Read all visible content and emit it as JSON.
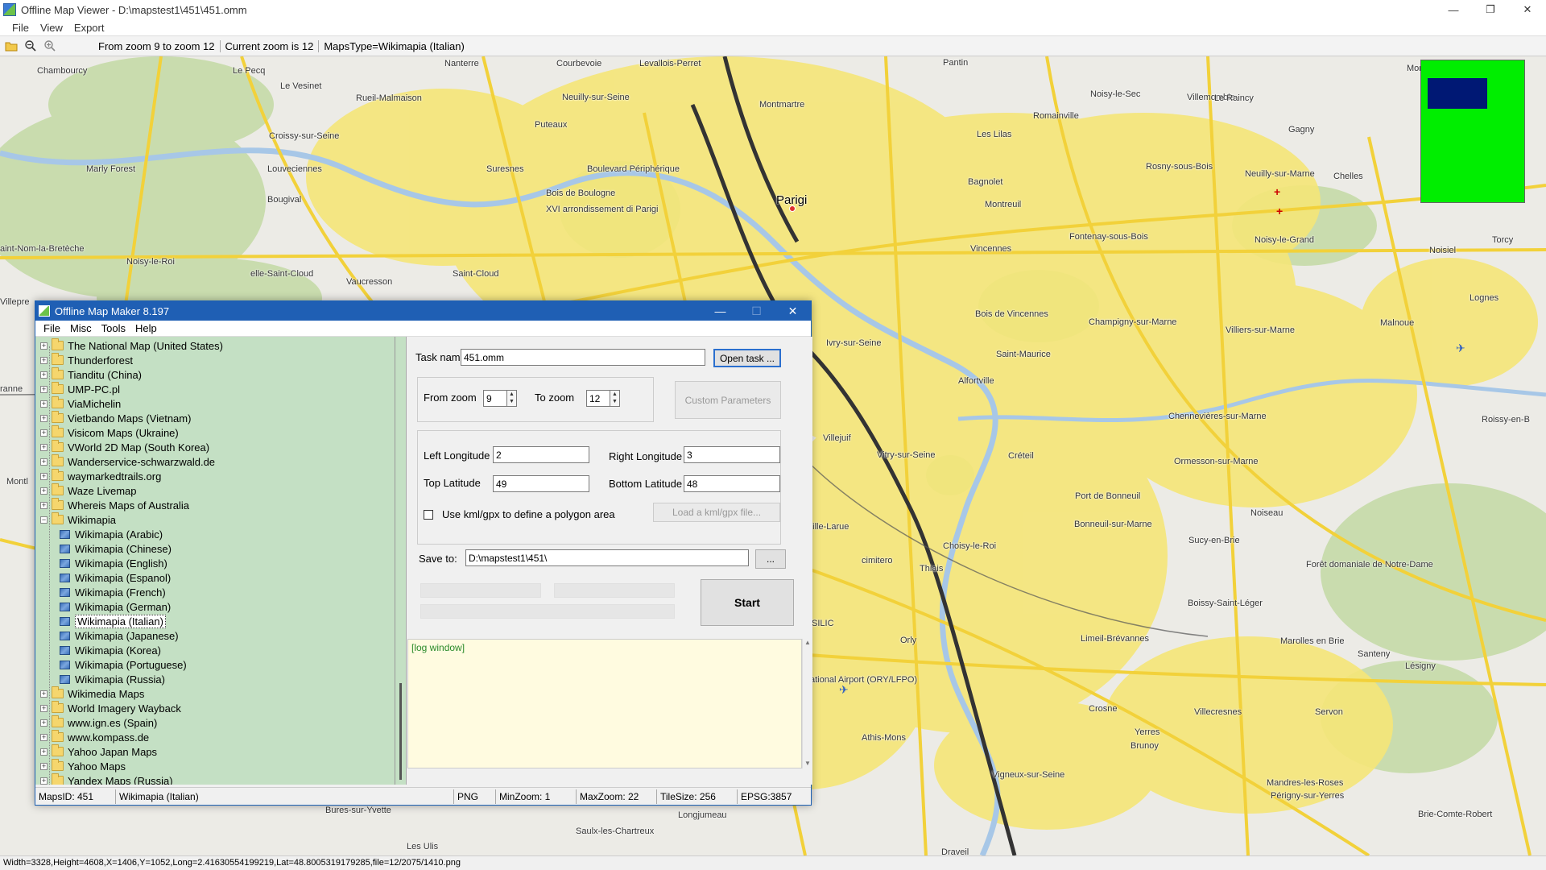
{
  "viewer": {
    "title": "Offline Map Viewer - D:\\mapstest1\\451\\451.omm",
    "menu": [
      "File",
      "View",
      "Export"
    ],
    "toolbar": {
      "zoom_range": "From zoom 9 to zoom 12",
      "current_zoom": "Current zoom is 12",
      "maps_type": "MapsType=Wikimapia (Italian)"
    },
    "status": "Width=3328,Height=4608,X=1406,Y=1052,Long=2.41630554199219,Lat=48.8005319179285,file=12/2075/1410.png"
  },
  "map_labels": [
    {
      "text": "Chambourcy"
    },
    {
      "text": "Le Pecq"
    },
    {
      "text": "Nanterre"
    },
    {
      "text": "Courbevoie"
    },
    {
      "text": "Levallois-Perret"
    },
    {
      "text": "Pantin"
    },
    {
      "text": "Montfermeil"
    },
    {
      "text": "Le Vesinet"
    },
    {
      "text": "Rueil-Malmaison"
    },
    {
      "text": "Neuilly-sur-Seine"
    },
    {
      "text": "Noisy-le-Sec"
    },
    {
      "text": "Villemomble"
    },
    {
      "text": "Le Raincy"
    },
    {
      "text": "Montmartre"
    },
    {
      "text": "Puteaux"
    },
    {
      "text": "Romainville"
    },
    {
      "text": "Croissy-sur-Seine"
    },
    {
      "text": "Gagny"
    },
    {
      "text": "Les Lilas"
    },
    {
      "text": "Marly Forest"
    },
    {
      "text": "Louveciennes"
    },
    {
      "text": "Suresnes"
    },
    {
      "text": "Boulevard Périphérique"
    },
    {
      "text": "Rosny-sous-Bois"
    },
    {
      "text": "Neuilly-sur-Marne"
    },
    {
      "text": "Chelles"
    },
    {
      "text": "Bagnolet"
    },
    {
      "text": "Bougival"
    },
    {
      "text": "Bois de Boulogne"
    },
    {
      "text": "Parigi"
    },
    {
      "text": "XVI arrondissement di Parigi"
    },
    {
      "text": "Montreuil"
    },
    {
      "text": "Fontenay-sous-Bois"
    },
    {
      "text": "Noisy-le-Grand"
    },
    {
      "text": "Torcy"
    },
    {
      "text": "aint-Nom-la-Bretèche"
    },
    {
      "text": "Noisy-le-Roi"
    },
    {
      "text": "Vincennes"
    },
    {
      "text": "Noisiel"
    },
    {
      "text": "elle-Saint-Cloud"
    },
    {
      "text": "Saint-Cloud"
    },
    {
      "text": "Vaucresson"
    },
    {
      "text": "Lognes"
    },
    {
      "text": "Villepre"
    },
    {
      "text": "Bois de Vincennes"
    },
    {
      "text": "Champigny-sur-Marne"
    },
    {
      "text": "Malnoue"
    },
    {
      "text": "Villiers-sur-Marne"
    },
    {
      "text": "Ivry-sur-Seine"
    },
    {
      "text": "Saint-Maurice"
    },
    {
      "text": "Alfortville"
    },
    {
      "text": "Chennevières-sur-Marne"
    },
    {
      "text": "Roissy-en-B"
    },
    {
      "text": "Villejuif"
    },
    {
      "text": "Vitry-sur-Seine"
    },
    {
      "text": "Créteil"
    },
    {
      "text": "Ormesson-sur-Marne"
    },
    {
      "text": "Port de Bonneuil"
    },
    {
      "text": "Noiseau"
    },
    {
      "text": "Ville-Larue"
    },
    {
      "text": "Bonneuil-sur-Marne"
    },
    {
      "text": "Sucy-en-Brie"
    },
    {
      "text": "Choisy-le-Roi"
    },
    {
      "text": "cimitero"
    },
    {
      "text": "Thiais"
    },
    {
      "text": "Forêt domaniale de Notre-Dame"
    },
    {
      "text": "Boissy-Saint-Léger"
    },
    {
      "text": "SILIC"
    },
    {
      "text": "Orly"
    },
    {
      "text": "Limeil-Brévannes"
    },
    {
      "text": "Marolles en Brie"
    },
    {
      "text": "Santeny"
    },
    {
      "text": "ational Airport (ORY/LFPO)"
    },
    {
      "text": "Lésigny"
    },
    {
      "text": "Crosne"
    },
    {
      "text": "Villecresnes"
    },
    {
      "text": "Servon"
    },
    {
      "text": "Athis-Mons"
    },
    {
      "text": "Yerres"
    },
    {
      "text": "Brunoy"
    },
    {
      "text": "Vigneux-sur-Seine"
    },
    {
      "text": "Mandres-les-Roses"
    },
    {
      "text": "Périgny-sur-Yerres"
    },
    {
      "text": "Bures-sur-Yvette"
    },
    {
      "text": "Longjumeau"
    },
    {
      "text": "Brie-Comte-Robert"
    },
    {
      "text": "Saulx-les-Chartreux"
    },
    {
      "text": "Les Ulis"
    },
    {
      "text": "Draveil"
    },
    {
      "text": "Montl"
    },
    {
      "text": "ranne"
    }
  ],
  "dialog": {
    "title": "Offline Map Maker 8.197",
    "menu": [
      "File",
      "Misc",
      "Tools",
      "Help"
    ],
    "tree": [
      {
        "label": "The National Map (United States)",
        "level": 0,
        "expander": "+"
      },
      {
        "label": "Thunderforest",
        "level": 0,
        "expander": "+"
      },
      {
        "label": "Tianditu (China)",
        "level": 0,
        "expander": "+"
      },
      {
        "label": "UMP-PC.pl",
        "level": 0,
        "expander": "+"
      },
      {
        "label": "ViaMichelin",
        "level": 0,
        "expander": "+"
      },
      {
        "label": "Vietbando Maps (Vietnam)",
        "level": 0,
        "expander": "+"
      },
      {
        "label": "Visicom Maps (Ukraine)",
        "level": 0,
        "expander": "+"
      },
      {
        "label": "VWorld 2D Map (South Korea)",
        "level": 0,
        "expander": "+"
      },
      {
        "label": "Wanderservice-schwarzwald.de",
        "level": 0,
        "expander": "+"
      },
      {
        "label": "waymarkedtrails.org",
        "level": 0,
        "expander": "+"
      },
      {
        "label": "Waze Livemap",
        "level": 0,
        "expander": "+"
      },
      {
        "label": "Whereis Maps of Australia",
        "level": 0,
        "expander": "+"
      },
      {
        "label": "Wikimapia",
        "level": 0,
        "expander": "−"
      },
      {
        "label": "Wikimapia (Arabic)",
        "level": 1,
        "expander": ""
      },
      {
        "label": "Wikimapia (Chinese)",
        "level": 1,
        "expander": ""
      },
      {
        "label": "Wikimapia (English)",
        "level": 1,
        "expander": ""
      },
      {
        "label": "Wikimapia (Espanol)",
        "level": 1,
        "expander": ""
      },
      {
        "label": "Wikimapia (French)",
        "level": 1,
        "expander": ""
      },
      {
        "label": "Wikimapia (German)",
        "level": 1,
        "expander": ""
      },
      {
        "label": "Wikimapia (Italian)",
        "level": 1,
        "expander": "",
        "selected": true
      },
      {
        "label": "Wikimapia (Japanese)",
        "level": 1,
        "expander": ""
      },
      {
        "label": "Wikimapia (Korea)",
        "level": 1,
        "expander": ""
      },
      {
        "label": "Wikimapia (Portuguese)",
        "level": 1,
        "expander": ""
      },
      {
        "label": "Wikimapia (Russia)",
        "level": 1,
        "expander": ""
      },
      {
        "label": "Wikimedia Maps",
        "level": 0,
        "expander": "+"
      },
      {
        "label": "World Imagery Wayback",
        "level": 0,
        "expander": "+"
      },
      {
        "label": "www.ign.es (Spain)",
        "level": 0,
        "expander": "+"
      },
      {
        "label": "www.kompass.de",
        "level": 0,
        "expander": "+"
      },
      {
        "label": "Yahoo Japan Maps",
        "level": 0,
        "expander": "+"
      },
      {
        "label": "Yahoo Maps",
        "level": 0,
        "expander": "+"
      },
      {
        "label": "Yandex Maps (Russia)",
        "level": 0,
        "expander": "+"
      }
    ],
    "task": {
      "label": "Task name",
      "value": "451.omm",
      "open_btn": "Open task ..."
    },
    "zoom": {
      "from_label": "From zoom",
      "from_value": "9",
      "to_label": "To zoom",
      "to_value": "12",
      "custom_btn": "Custom Parameters"
    },
    "bounds": {
      "left_label": "Left Longitude",
      "left_value": "2",
      "right_label": "Right Longitude",
      "right_value": "3",
      "top_label": "Top Latitude",
      "top_value": "49",
      "bottom_label": "Bottom Latitude",
      "bottom_value": "48",
      "kml_label": "Use kml/gpx to define a polygon area",
      "kml_btn": "Load a kml/gpx file..."
    },
    "save": {
      "label": "Save to:",
      "value": "D:\\mapstest1\\451\\",
      "browse_btn": "..."
    },
    "start_btn": "Start",
    "log": "[log window]",
    "status": {
      "maps_id": "MapsID: 451",
      "maps_name": "Wikimapia (Italian)",
      "format": "PNG",
      "min_zoom": "MinZoom: 1",
      "max_zoom": "MaxZoom: 22",
      "tile_size": "TileSize: 256",
      "epsg": "EPSG:3857"
    }
  }
}
